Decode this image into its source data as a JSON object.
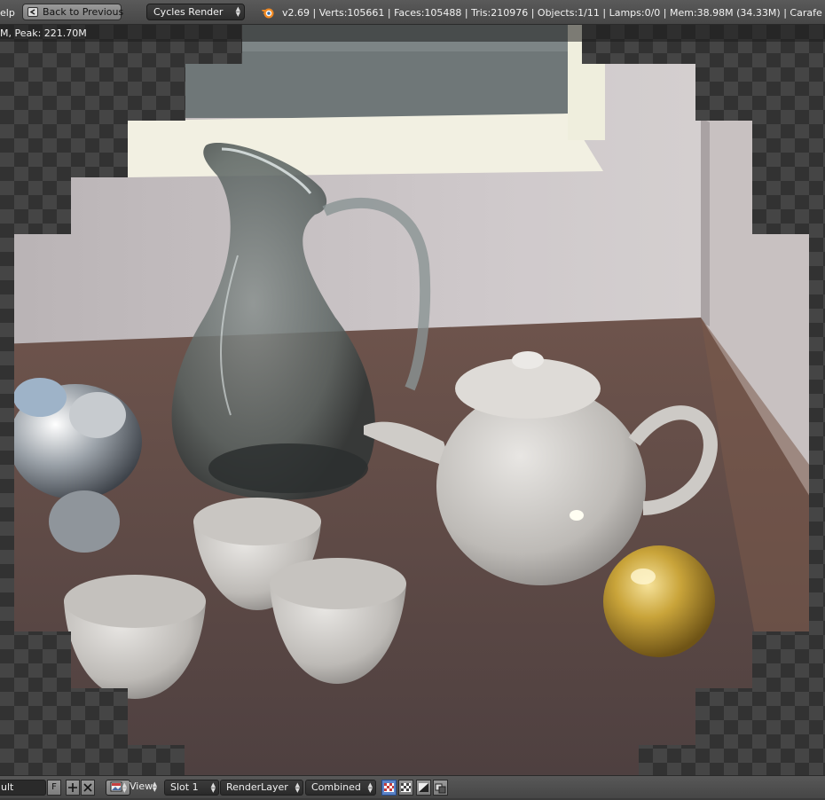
{
  "header": {
    "help_menu": "elp",
    "back_button": "Back to Previous",
    "render_engine": "Cycles Render",
    "stats": "v2.69 | Verts:105661 | Faces:105488 | Tris:210976 | Objects:1/11 | Lamps:0/0 | Mem:38.98M (34.33M) | Carafe"
  },
  "render": {
    "info_line": "M, Peak: 221.70M"
  },
  "footer": {
    "image_name": "ult",
    "fake_user": "F",
    "view_menu": "View",
    "slot": "Slot 1",
    "render_layer": "RenderLayer",
    "render_pass": "Combined"
  },
  "colors": {
    "checker_light": "#454545",
    "checker_dark": "#323232",
    "active_toggle": "#5b83c7",
    "gold_sphere": "#c9a43a"
  },
  "icons": [
    "back-arrow-icon",
    "blender-logo-icon",
    "image-editor-icon",
    "add-icon",
    "unlink-icon",
    "alpha-checker-icon",
    "z-buffer-icon",
    "copy-icon"
  ]
}
